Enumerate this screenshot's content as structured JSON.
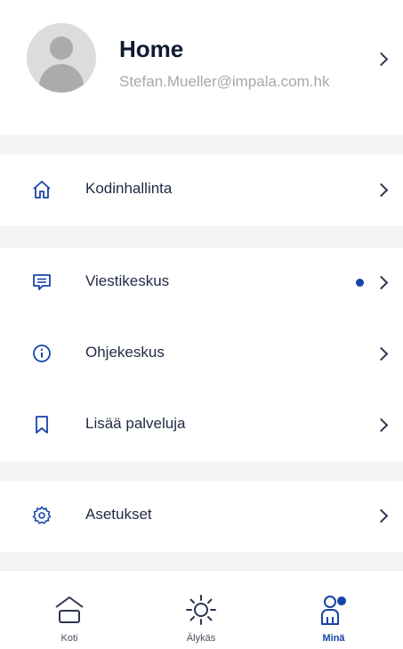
{
  "profile": {
    "name": "Home",
    "email": "Stefan.Mueller@impala.com.hk"
  },
  "menu": {
    "home_management": {
      "label": "Kodinhallinta",
      "icon": "house-icon"
    },
    "message_center": {
      "label": "Viestikeskus",
      "icon": "message-icon",
      "unread_dot": true
    },
    "help_center": {
      "label": "Ohjekeskus",
      "icon": "info-icon"
    },
    "more_services": {
      "label": "Lisää palveluja",
      "icon": "bookmark-icon"
    },
    "settings": {
      "label": "Asetukset",
      "icon": "gear-icon"
    }
  },
  "tabs": [
    {
      "label": "Koti",
      "icon": "home-tab-icon",
      "active": false
    },
    {
      "label": "Älykäs",
      "icon": "sun-icon",
      "active": false
    },
    {
      "label": "Minä",
      "icon": "profile-icon",
      "active": true
    }
  ],
  "colors": {
    "accent": "#1744a8",
    "text": "#1f2a44",
    "muted": "#a8a8a8",
    "band": "#f4f4f6"
  }
}
